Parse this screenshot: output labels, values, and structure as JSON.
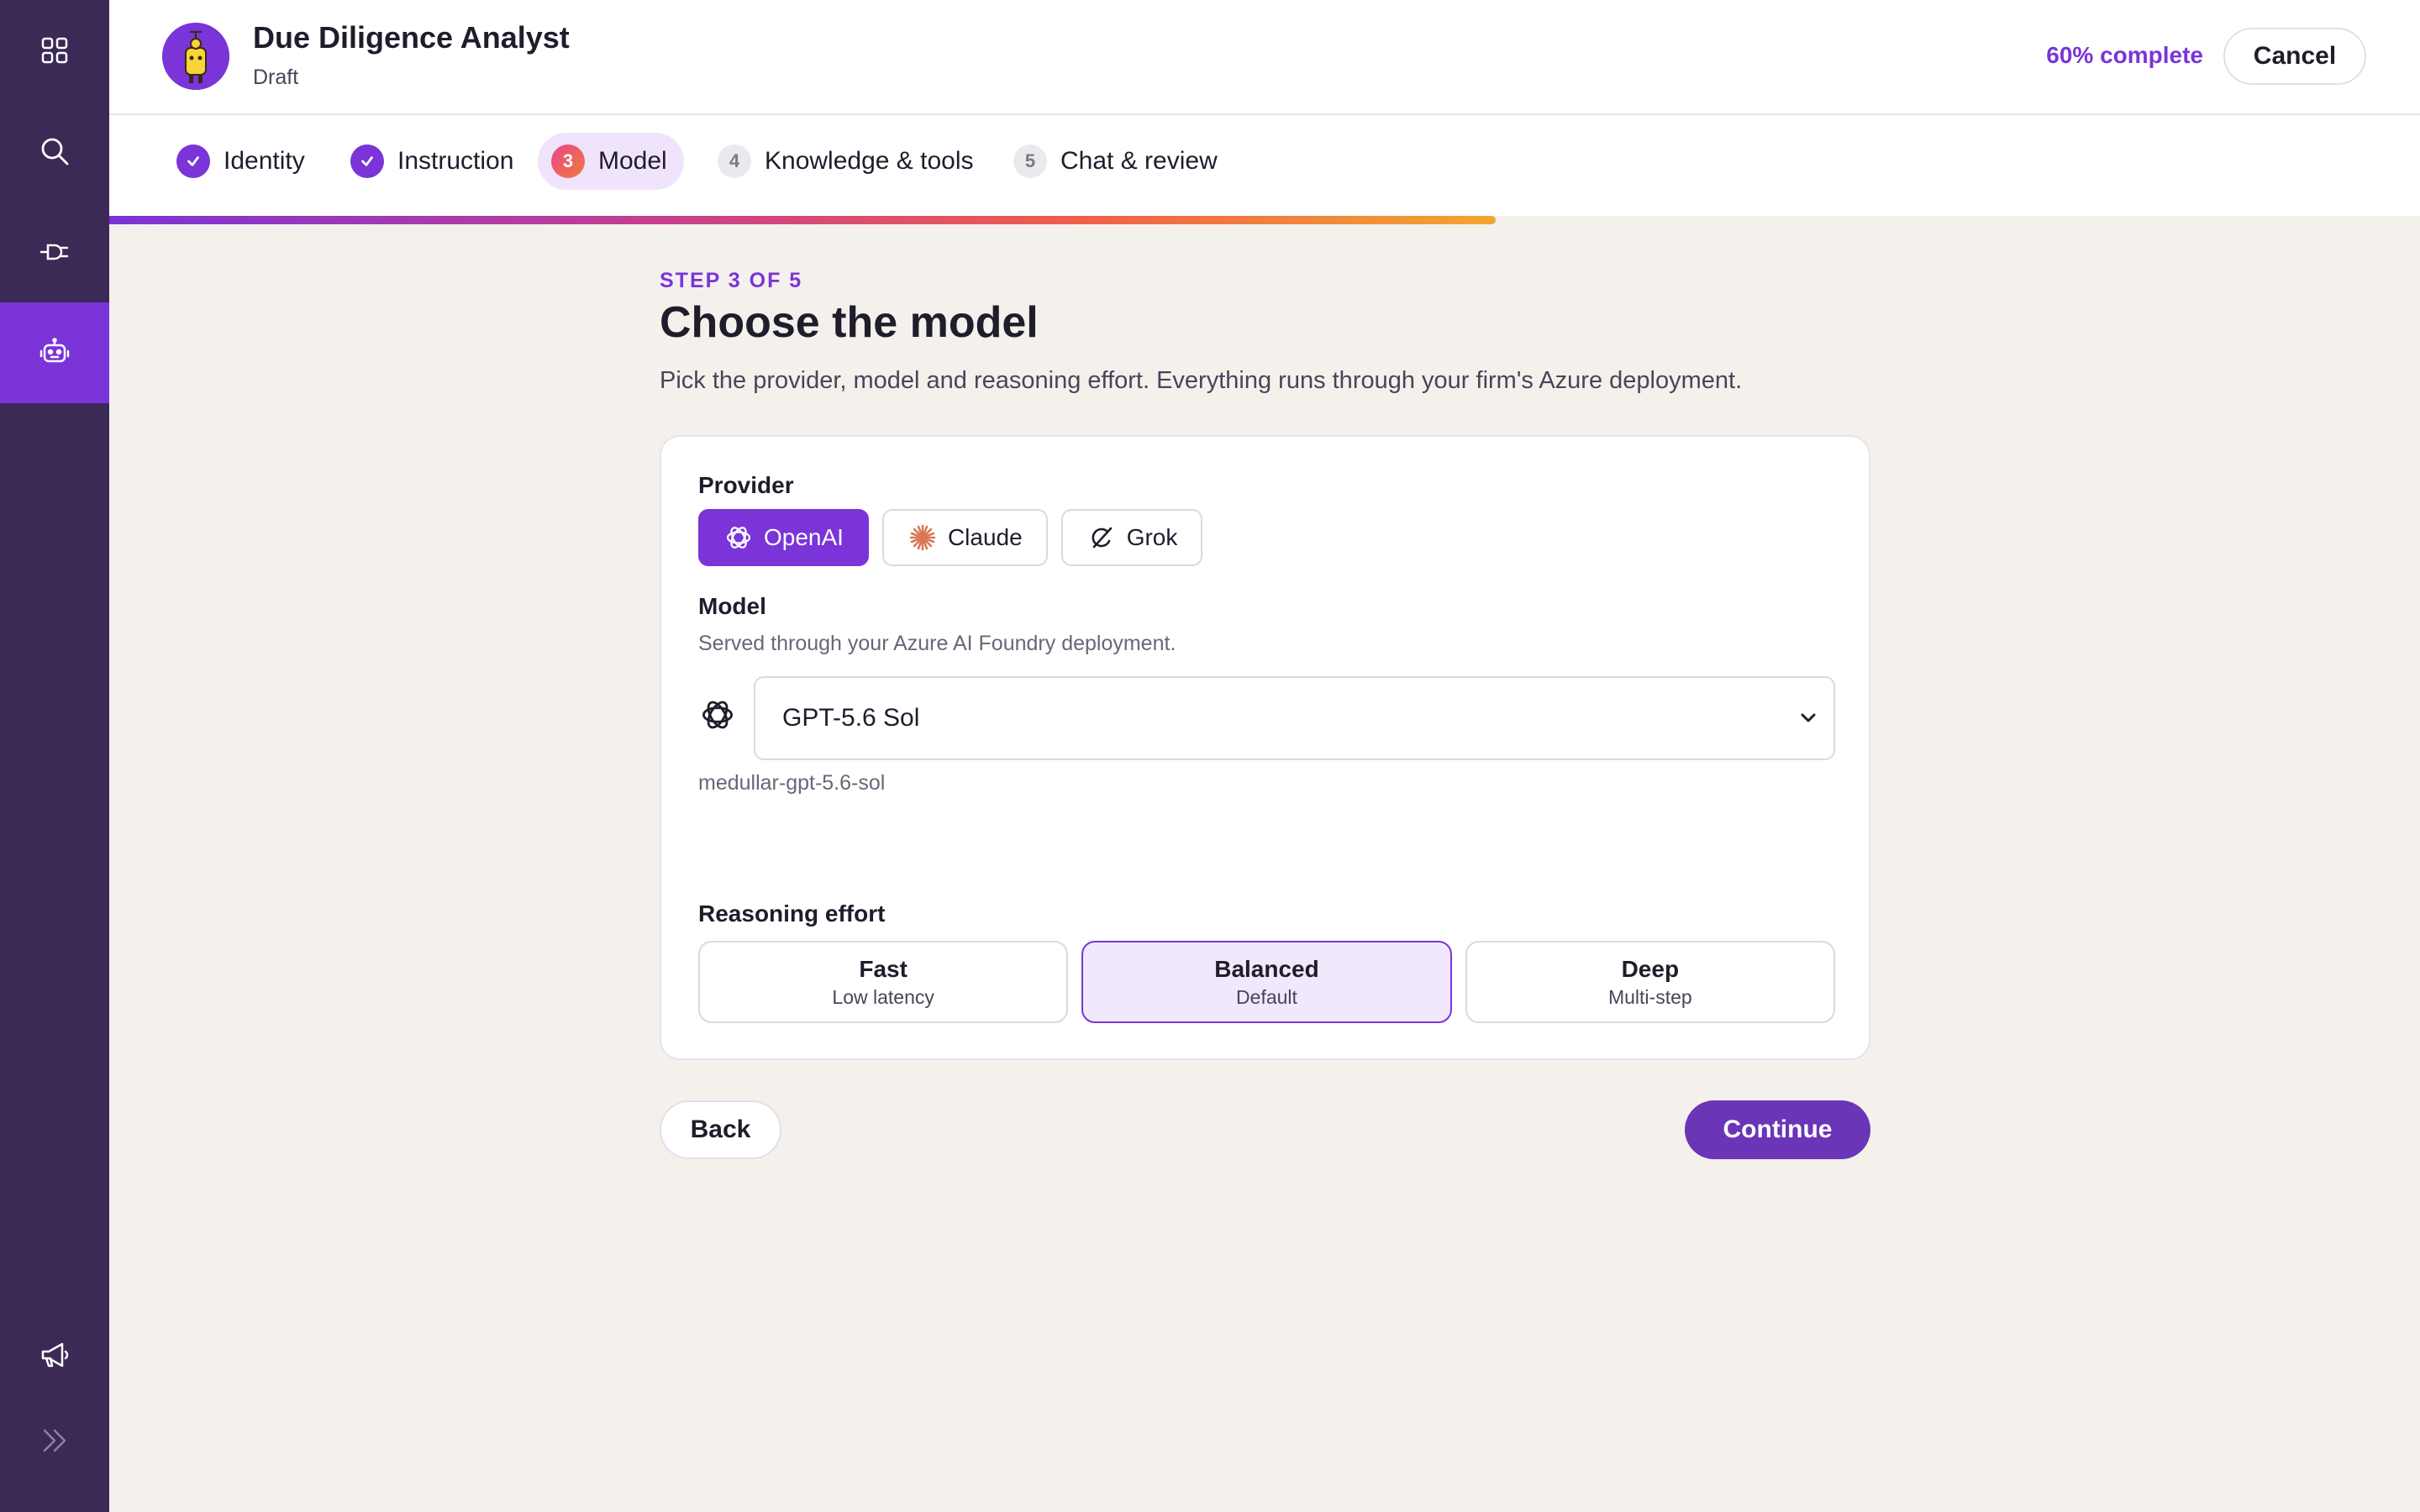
{
  "sidebar": {
    "items": [
      {
        "name": "apps-grid-icon"
      },
      {
        "name": "search-icon"
      },
      {
        "name": "plug-icon"
      },
      {
        "name": "robot-icon",
        "active": true
      },
      {
        "name": "megaphone-icon"
      },
      {
        "name": "expand-chevrons-icon"
      }
    ]
  },
  "header": {
    "agent_name": "Due Diligence Analyst",
    "status": "Draft",
    "progress_label": "60% complete",
    "progress_fraction": 0.6,
    "cancel_label": "Cancel"
  },
  "steps": [
    {
      "number": "1",
      "label": "Identity",
      "state": "done"
    },
    {
      "number": "2",
      "label": "Instruction",
      "state": "done"
    },
    {
      "number": "3",
      "label": "Model",
      "state": "current"
    },
    {
      "number": "4",
      "label": "Knowledge & tools",
      "state": "todo"
    },
    {
      "number": "5",
      "label": "Chat & review",
      "state": "todo"
    }
  ],
  "main": {
    "kicker": "STEP 3 OF 5",
    "title": "Choose the model",
    "subtitle": "Pick the provider, model and reasoning effort. Everything runs through your firm's Azure deployment."
  },
  "provider": {
    "label": "Provider",
    "options": [
      {
        "label": "OpenAI",
        "icon": "openai-icon",
        "selected": true
      },
      {
        "label": "Claude",
        "icon": "claude-icon",
        "selected": false
      },
      {
        "label": "Grok",
        "icon": "grok-icon",
        "selected": false
      }
    ]
  },
  "model": {
    "label": "Model",
    "hint": "Served through your Azure AI Foundry deployment.",
    "selected_value": "GPT-5.6 Sol",
    "deployment_id": "medullar-gpt-5.6-sol"
  },
  "reasoning": {
    "label": "Reasoning effort",
    "options": [
      {
        "name": "Fast",
        "desc": "Low latency",
        "selected": false
      },
      {
        "name": "Balanced",
        "desc": "Default",
        "selected": true
      },
      {
        "name": "Deep",
        "desc": "Multi-step",
        "selected": false
      }
    ]
  },
  "footer": {
    "back_label": "Back",
    "continue_label": "Continue"
  },
  "colors": {
    "accent": "#7a34d8",
    "sidebar": "#3b2a55",
    "continue": "#6a35b7",
    "claude": "#d97757"
  }
}
